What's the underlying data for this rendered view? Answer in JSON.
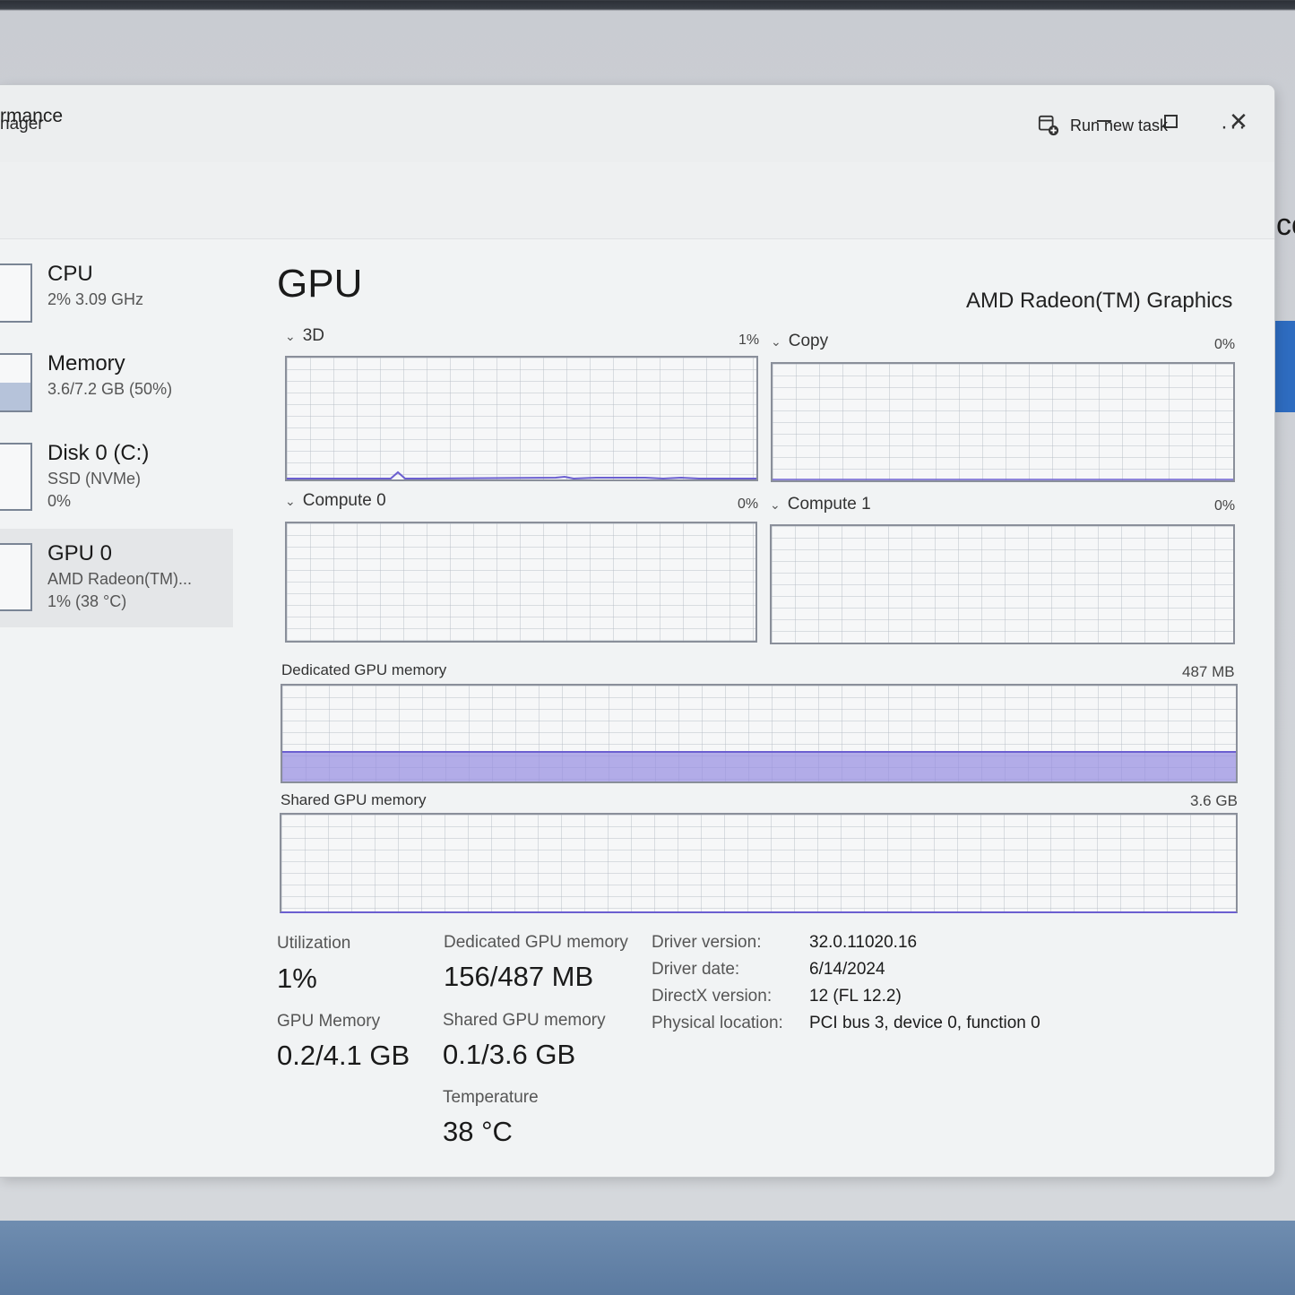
{
  "window": {
    "title": "nager"
  },
  "window_controls": {
    "close_glyph": "✕"
  },
  "commandbar": {
    "section_title": "rmance",
    "run_new_task": "Run new task",
    "more": "···"
  },
  "sidebar": {
    "items": [
      {
        "name": "CPU",
        "line1": "2%  3.09 GHz",
        "line2": ""
      },
      {
        "name": "Memory",
        "line1": "3.6/7.2 GB (50%)",
        "line2": ""
      },
      {
        "name": "Disk 0 (C:)",
        "line1": "SSD (NVMe)",
        "line2": "0%"
      },
      {
        "name": "GPU 0",
        "line1": "AMD Radeon(TM)...",
        "line2": "1% (38 °C)"
      }
    ],
    "memory_fill_fraction": 0.5
  },
  "main": {
    "title": "GPU",
    "model": "AMD Radeon(TM) Graphics",
    "engines": [
      {
        "name": "3D",
        "percent": "1%"
      },
      {
        "name": "Copy",
        "percent": "0%"
      },
      {
        "name": "Compute 0",
        "percent": "0%"
      },
      {
        "name": "Compute 1",
        "percent": "0%"
      }
    ],
    "dedicated_memory": {
      "label": "Dedicated GPU memory",
      "max": "487 MB",
      "used_fraction": 0.32
    },
    "shared_memory": {
      "label": "Shared GPU memory",
      "max": "3.6 GB"
    }
  },
  "stats": {
    "utilization_label": "Utilization",
    "utilization": "1%",
    "dedicated_label": "Dedicated GPU memory",
    "dedicated": "156/487 MB",
    "gpu_memory_label": "GPU Memory",
    "gpu_memory": "0.2/4.1 GB",
    "shared_label": "Shared GPU memory",
    "shared": "0.1/3.6 GB",
    "temperature_label": "Temperature",
    "temperature": "38 °C"
  },
  "info": {
    "driver_version_label": "Driver version:",
    "driver_version": "32.0.11020.16",
    "driver_date_label": "Driver date:",
    "driver_date": "6/14/2024",
    "directx_label": "DirectX version:",
    "directx": "12 (FL 12.2)",
    "location_label": "Physical location:",
    "location": "PCI bus 3, device 0, function 0"
  },
  "background": {
    "edge_text": "co"
  },
  "colors": {
    "accent": "#6b5fd0",
    "memory_fill": "#968ce1",
    "graph_border": "#8a8f9a"
  }
}
